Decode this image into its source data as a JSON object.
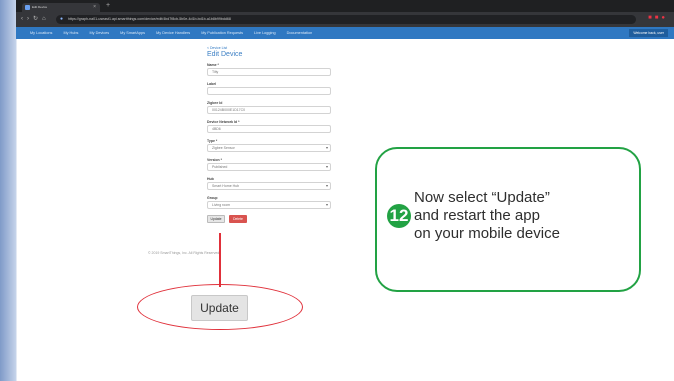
{
  "browser": {
    "tab_title": "Edit Device",
    "url": "https://graph-na01-useast1.api.smartthings.com/device/edit/4bd7f8cb-5b0e-4d1b-bd1b-a1b8b99bdd68"
  },
  "nav": {
    "items": [
      "My Locations",
      "My Hubs",
      "My Devices",
      "My SmartApps",
      "My Device Handlers",
      "My Publication Requests",
      "Live Logging",
      "Documentation"
    ],
    "user": "Welcome back, user"
  },
  "form": {
    "back_link": "< Device List",
    "title": "Edit Device",
    "fields": [
      {
        "label": "Name *",
        "value": "Tilty"
      },
      {
        "label": "Label",
        "value": ""
      },
      {
        "label": "Zigbee Id",
        "value": "00124B000E1D17C0"
      },
      {
        "label": "Device Network Id *",
        "value": "4BD6"
      },
      {
        "label": "Type *",
        "value": "Zigbee Sensor"
      },
      {
        "label": "Version *",
        "value": "Published"
      },
      {
        "label": "Hub",
        "value": "Smart Home Hub"
      },
      {
        "label": "Group",
        "value": "Living room"
      }
    ],
    "update_label": "Update",
    "delete_label": "Delete"
  },
  "footer": {
    "copyright": "© 2019 SmartThings, Inc. All Rights Reserved."
  },
  "annotation": {
    "zoomed_button_label": "Update",
    "step_number": "12",
    "instruction": "Now select “Update”\nand restart the app\non your mobile device"
  }
}
